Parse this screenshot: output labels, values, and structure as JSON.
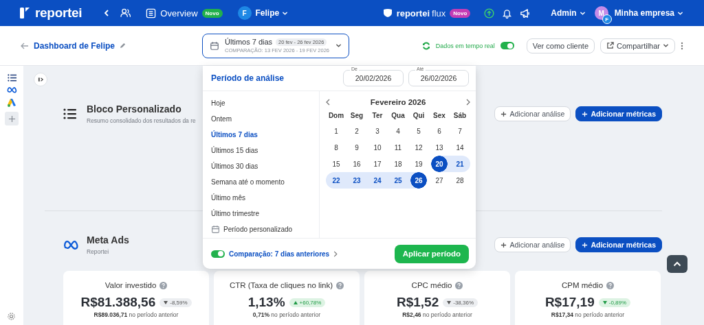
{
  "topbar": {
    "logo": "reportei",
    "overview": {
      "label": "Overview",
      "badge": "Novo"
    },
    "client": {
      "initial": "F",
      "name": "Felipe"
    },
    "flux": {
      "brand": "reportei",
      "product": "flux",
      "badge": "Novo"
    },
    "admin": "Admin",
    "company": {
      "initial": "M",
      "badge": "F",
      "name": "Minha empresa"
    }
  },
  "header": {
    "title": "Dashboard de Felipe",
    "period": {
      "label": "Últimos 7 dias",
      "range": "20 fev - 26 fev 2026",
      "comparison": "COMPARAÇÃO: 13 FEV 2026 - 19 FEV 2026"
    },
    "realtime": {
      "label": "Dados em tempo real",
      "on": true
    },
    "view_button": "Ver como cliente",
    "share_button": "Compartilhar"
  },
  "blocks": [
    {
      "kind": "custom",
      "title": "Bloco Personalizado",
      "subtitle": "Resumo consolidado dos resultados da re",
      "buttons": [
        "Adicionar análise",
        "Adicionar métricas"
      ]
    },
    {
      "kind": "meta",
      "title": "Meta Ads",
      "subtitle": "Reportei",
      "buttons": [
        "Adicionar análise",
        "Adicionar métricas"
      ],
      "cards": [
        {
          "title": "Valor investido",
          "value": "R$81.388,56",
          "delta": {
            "text": "-8,59%",
            "increase": false,
            "favorable": false
          },
          "previous": "**R$89.036,71** no período anterior"
        },
        {
          "title": "CTR (Taxa de cliques no link)",
          "value": "1,13%",
          "delta": {
            "text": "+60,78%",
            "increase": true,
            "favorable": true
          },
          "previous": "**0,71%** no período anterior"
        },
        {
          "title": "CPC médio",
          "value": "R$1,52",
          "delta": {
            "text": "-38,36%",
            "increase": false,
            "favorable": false
          },
          "previous": "**R$2,46** no período anterior"
        },
        {
          "title": "CPM médio",
          "value": "R$17,19",
          "delta": {
            "text": "-0,89%",
            "increase": false,
            "favorable": true
          },
          "previous": "**R$17,34** no período anterior"
        }
      ]
    }
  ],
  "date_picker": {
    "title": "Período de análise",
    "fields": [
      {
        "label": "De",
        "value": "20/02/2026"
      },
      {
        "label": "Até",
        "value": "26/02/2026"
      }
    ],
    "presets": [
      {
        "kind": "preset",
        "label": "Hoje",
        "selected": false
      },
      {
        "kind": "preset",
        "label": "Ontem",
        "selected": false
      },
      {
        "kind": "preset",
        "label": "Últimos 7 dias",
        "selected": true
      },
      {
        "kind": "preset",
        "label": "Últimos 15 dias",
        "selected": false
      },
      {
        "kind": "preset",
        "label": "Últimos 30 dias",
        "selected": false
      },
      {
        "kind": "preset",
        "label": "Semana até o momento",
        "selected": false
      },
      {
        "kind": "preset",
        "label": "Último mês",
        "selected": false
      },
      {
        "kind": "preset",
        "label": "Último trimestre",
        "selected": false
      },
      {
        "kind": "custom",
        "label": "Período personalizado",
        "selected": false
      }
    ],
    "calendar": {
      "month": "Fevereiro 2026",
      "weekdays": [
        "Dom",
        "Seg",
        "Ter",
        "Qua",
        "Qui",
        "Sex",
        "Sáb"
      ],
      "days": [
        {
          "label": "1",
          "selected": false,
          "in_range": false
        },
        {
          "label": "2",
          "selected": false,
          "in_range": false
        },
        {
          "label": "3",
          "selected": false,
          "in_range": false
        },
        {
          "label": "4",
          "selected": false,
          "in_range": false
        },
        {
          "label": "5",
          "selected": false,
          "in_range": false
        },
        {
          "label": "6",
          "selected": false,
          "in_range": false
        },
        {
          "label": "7",
          "selected": false,
          "in_range": false
        },
        {
          "label": "8",
          "selected": false,
          "in_range": false
        },
        {
          "label": "9",
          "selected": false,
          "in_range": false
        },
        {
          "label": "10",
          "selected": false,
          "in_range": false
        },
        {
          "label": "11",
          "selected": false,
          "in_range": false
        },
        {
          "label": "12",
          "selected": false,
          "in_range": false
        },
        {
          "label": "13",
          "selected": false,
          "in_range": false
        },
        {
          "label": "14",
          "selected": false,
          "in_range": false
        },
        {
          "label": "15",
          "selected": false,
          "in_range": false
        },
        {
          "label": "16",
          "selected": false,
          "in_range": false
        },
        {
          "label": "17",
          "selected": false,
          "in_range": false
        },
        {
          "label": "18",
          "selected": false,
          "in_range": false
        },
        {
          "label": "19",
          "selected": false,
          "in_range": false
        },
        {
          "label": "20",
          "selected": true,
          "in_range": false
        },
        {
          "label": "21",
          "selected": false,
          "in_range": true
        },
        {
          "label": "22",
          "selected": false,
          "in_range": true
        },
        {
          "label": "23",
          "selected": false,
          "in_range": true
        },
        {
          "label": "24",
          "selected": false,
          "in_range": true
        },
        {
          "label": "25",
          "selected": false,
          "in_range": true
        },
        {
          "label": "26",
          "selected": true,
          "in_range": false
        },
        {
          "label": "27",
          "selected": false,
          "in_range": false
        },
        {
          "label": "28",
          "selected": false,
          "in_range": false
        }
      ]
    },
    "comparison": {
      "label": "Comparação: 7 dias anteriores",
      "on": true
    },
    "apply_button": "Aplicar período"
  }
}
